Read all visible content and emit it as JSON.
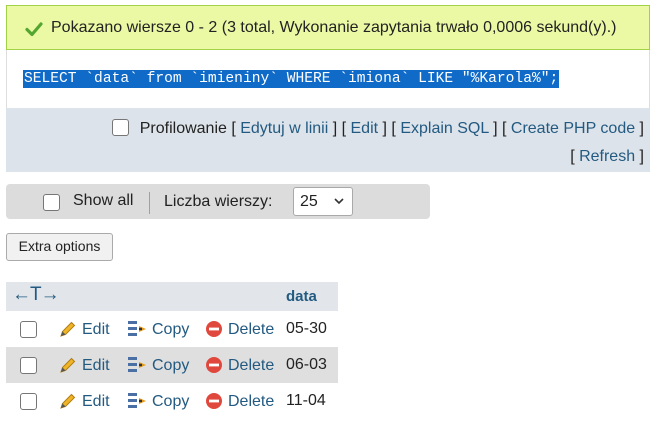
{
  "message": {
    "text": "Pokazano wiersze 0 - 2 (3 total, Wykonanie zapytania trwało 0,0006 sekund(y).)",
    "icon": "check-icon",
    "bg_color": "#ebf8a4"
  },
  "query": {
    "sql": "SELECT `data` from `imieniny` WHERE `imiona` LIKE \"%Karola%\";",
    "highlight_color": "#0f6ac8"
  },
  "query_tools": {
    "profiling_label": "Profilowanie",
    "links": [
      "Edytuj w linii",
      "Edit",
      "Explain SQL",
      "Create PHP code",
      "Refresh"
    ]
  },
  "navigation": {
    "show_all_label": "Show all",
    "rows_label": "Liczba wierszy:",
    "rows_value": "25"
  },
  "extra_options_label": "Extra options",
  "table": {
    "column_header": "data",
    "sort_arrows": "←T→",
    "action_labels": {
      "edit": "Edit",
      "copy": "Copy",
      "delete": "Delete"
    },
    "rows": [
      {
        "data": "05-30"
      },
      {
        "data": "06-03"
      },
      {
        "data": "11-04"
      }
    ]
  }
}
